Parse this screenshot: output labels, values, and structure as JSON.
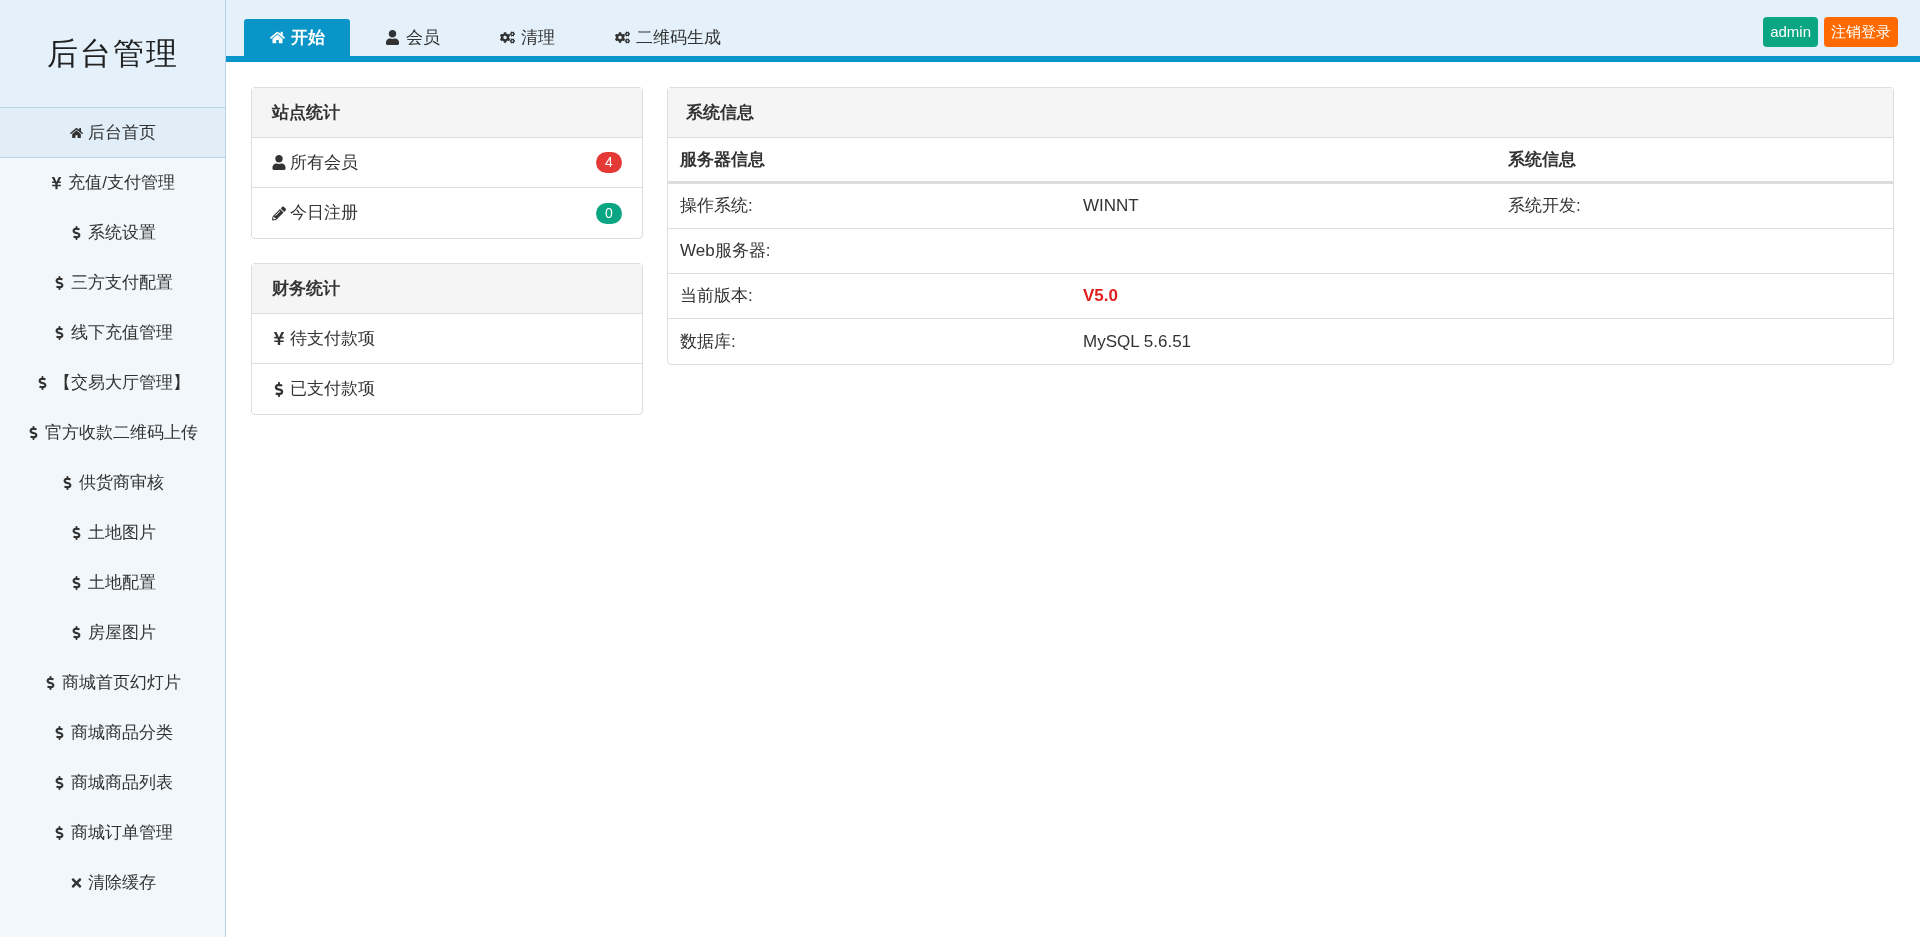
{
  "sidebar": {
    "logo": "后台管理",
    "items": [
      {
        "label": "后台首页",
        "kind": "home",
        "selected": true
      },
      {
        "label": "充值/支付管理",
        "kind": "yen",
        "selected": false
      },
      {
        "label": "系统设置",
        "kind": "dollar",
        "selected": false
      },
      {
        "label": "三方支付配置",
        "kind": "dollar",
        "selected": false
      },
      {
        "label": "线下充值管理",
        "kind": "dollar",
        "selected": false
      },
      {
        "label": "【交易大厅管理】",
        "kind": "dollar",
        "selected": false
      },
      {
        "label": "官方收款二维码上传",
        "kind": "dollar",
        "selected": false
      },
      {
        "label": "供货商审核",
        "kind": "dollar",
        "selected": false
      },
      {
        "label": "土地图片",
        "kind": "dollar",
        "selected": false
      },
      {
        "label": "土地配置",
        "kind": "dollar",
        "selected": false
      },
      {
        "label": "房屋图片",
        "kind": "dollar",
        "selected": false
      },
      {
        "label": "商城首页幻灯片",
        "kind": "dollar",
        "selected": false
      },
      {
        "label": "商城商品分类",
        "kind": "dollar",
        "selected": false
      },
      {
        "label": "商城商品列表",
        "kind": "dollar",
        "selected": false
      },
      {
        "label": "商城订单管理",
        "kind": "dollar",
        "selected": false
      },
      {
        "label": "清除缓存",
        "kind": "close",
        "selected": false
      }
    ]
  },
  "tabs": [
    {
      "label": "开始",
      "kind": "home",
      "selected": true
    },
    {
      "label": "会员",
      "kind": "user",
      "selected": false
    },
    {
      "label": "清理",
      "kind": "gears",
      "selected": false
    },
    {
      "label": "二维码生成",
      "kind": "gears",
      "selected": false
    }
  ],
  "header_buttons": [
    {
      "label": "admin",
      "color": "#0aa582"
    },
    {
      "label": "注销登录",
      "color": "#ff6a00"
    }
  ],
  "panels": [
    {
      "title": "站点统计",
      "rows": [
        {
          "label": "所有会员",
          "kind": "user",
          "badge": "4",
          "color": "#e53935"
        },
        {
          "label": "今日注册",
          "kind": "pencil",
          "badge": "0",
          "color": "#0aa582"
        }
      ]
    },
    {
      "title": "财务统计",
      "rows": [
        {
          "label": "待支付款项",
          "kind": "yen"
        },
        {
          "label": "已支付款项",
          "kind": "dollar"
        }
      ]
    }
  ],
  "system_info": {
    "title": "系统信息",
    "columns": [
      "服务器信息",
      "系统信息"
    ],
    "rows": [
      {
        "label": "操作系统:",
        "value": "WINNT",
        "highlight": false,
        "extra": "系统开发:"
      },
      {
        "label": "Web服务器:"
      },
      {
        "label": "当前版本:",
        "value": "V5.0",
        "highlight": true
      },
      {
        "label": "数据库:",
        "value": "MySQL 5.6.51",
        "highlight": false
      }
    ]
  }
}
